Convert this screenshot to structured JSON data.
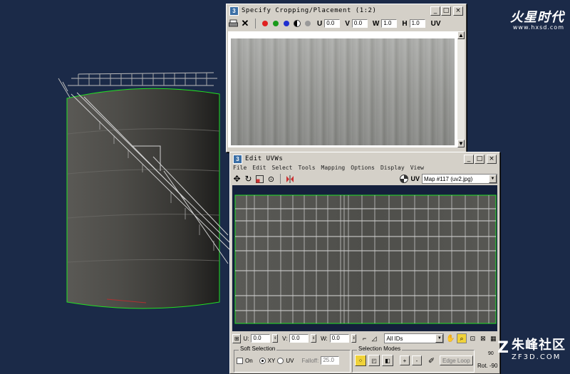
{
  "watermark_top": {
    "name": "火星时代",
    "url": "www.hxsd.com"
  },
  "watermark_bottom": {
    "name": "朱峰社区",
    "url": "ZF3D.COM"
  },
  "crop_window": {
    "title": "Specify Cropping/Placement (1:2)",
    "fields": {
      "u_label": "U",
      "u": "0.0",
      "v_label": "V",
      "v": "0.0",
      "w_label": "W",
      "w": "1.0",
      "h_label": "H",
      "h": "1.0",
      "uv_label": "UV"
    }
  },
  "uv_window": {
    "title": "Edit UVWs",
    "menu": [
      "File",
      "Edit",
      "Select",
      "Tools",
      "Mapping",
      "Options",
      "Display",
      "View"
    ],
    "uv_label": "UV",
    "map_select": "Map #117 (uv2.jpg)",
    "bottom": {
      "u_label": "U:",
      "u": "0.0",
      "v_label": "V:",
      "v": "0.0",
      "w_label": "W:",
      "w": "0.0",
      "ids_select": "All IDs"
    },
    "soft_selection": {
      "title": "Soft Selection",
      "on_label": "On",
      "xy_label": "XY",
      "uv_label": "UV",
      "falloff_label": "Falloff:",
      "falloff": "25.0"
    },
    "selection_modes": {
      "title": "Selection Modes",
      "edge_loop": "Edge Loop"
    },
    "rot": "Rot. -90",
    "num": "90"
  },
  "colors": {
    "bg": "#1b2a48",
    "tank": "#4a4a48",
    "green": "#22e022"
  }
}
